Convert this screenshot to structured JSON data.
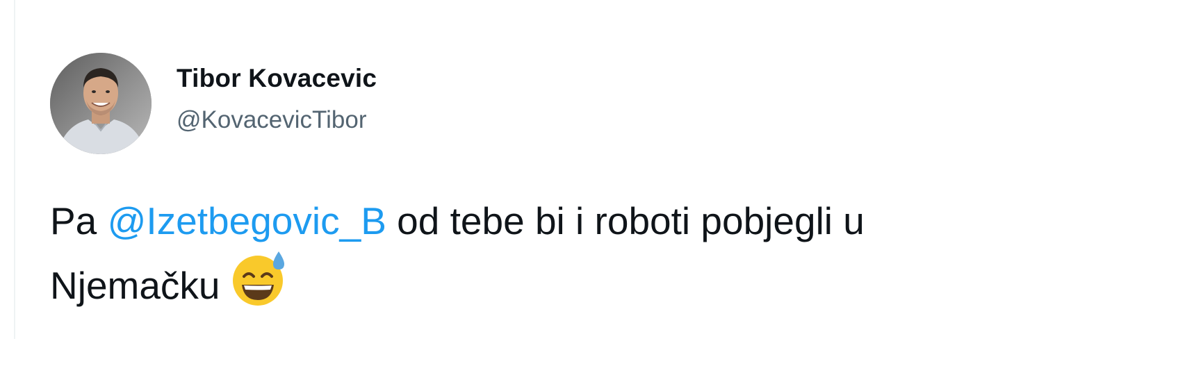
{
  "tweet": {
    "author": {
      "display_name": "Tibor Kovacevic",
      "handle": "@KovacevicTibor",
      "avatar_icon": "profile-photo"
    },
    "text": {
      "prefix": "Pa ",
      "mention": "@Izetbegovic_B",
      "line1_rest": " od tebe bi i roboti pobjegli u",
      "line2": "Njemačku",
      "emoji_icon": "grinning-face-with-sweat-emoji"
    }
  },
  "colors": {
    "mention": "#1d9bf0",
    "handle": "#536471",
    "text": "#0f1419",
    "emoji_face": "#f9c92b",
    "emoji_sweat": "#5aa7e0"
  }
}
